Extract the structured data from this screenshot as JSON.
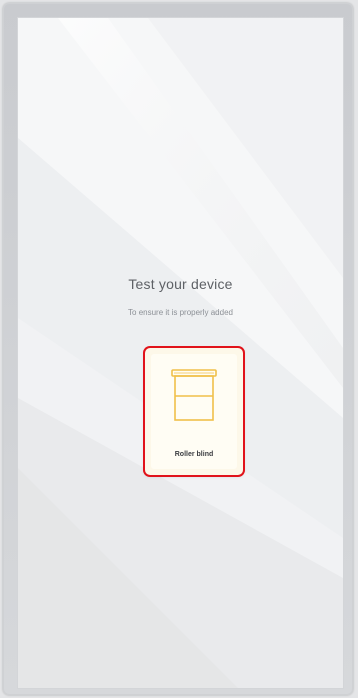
{
  "screen": {
    "title": "Test your device",
    "subtitle": "To ensure it is properly added"
  },
  "device_card": {
    "label": "Roller blind",
    "icon": "roller-blind-icon",
    "accent_color": "#f0c04a",
    "highlight_color": "#e1121a"
  }
}
